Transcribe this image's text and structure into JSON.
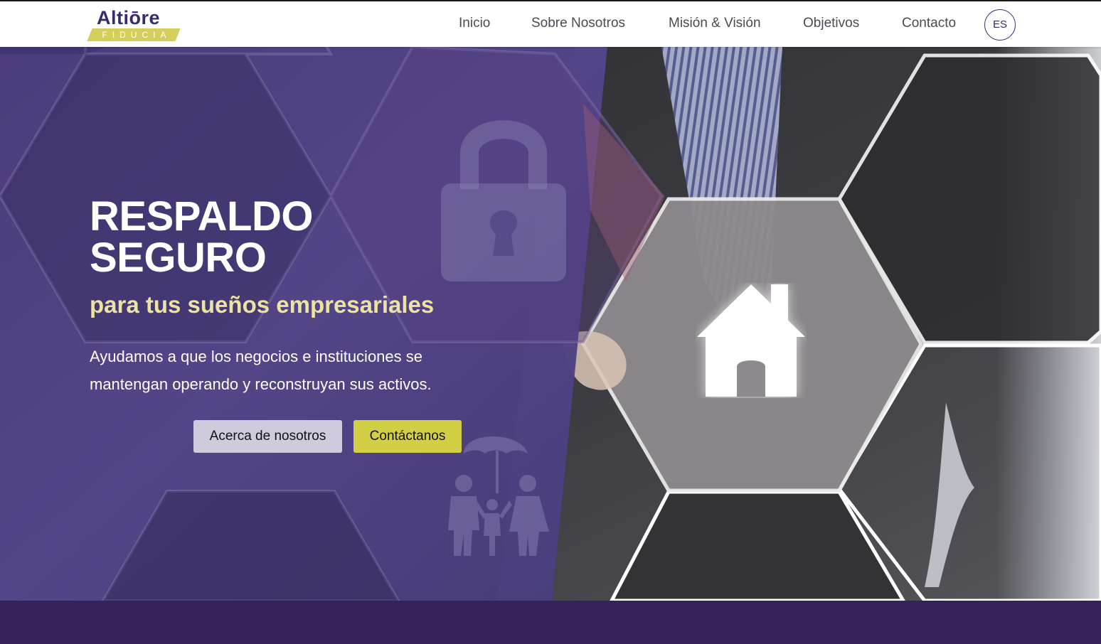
{
  "brand": {
    "name": "Altiōre",
    "tagline": "FIDUCIA",
    "colors": {
      "primary": "#3a2a6e",
      "accent": "#d3cf5a",
      "footer": "#36225a"
    }
  },
  "nav": {
    "items": [
      {
        "label": "Inicio"
      },
      {
        "label": "Sobre Nosotros"
      },
      {
        "label": "Misión & Visión"
      },
      {
        "label": "Objetivos"
      },
      {
        "label": "Contacto"
      }
    ],
    "language": "ES"
  },
  "hero": {
    "title_line1": "RESPALDO",
    "title_line2": "SEGURO",
    "subtitle": "para tus sueños empresariales",
    "description_line1": "Ayudamos a que los negocios e instituciones se",
    "description_line2": "mantengan operando y reconstruyan sus activos.",
    "button_about": "Acerca de nosotros",
    "button_contact": "Contáctanos",
    "icons": [
      "lock-icon",
      "house-icon",
      "family-umbrella-icon"
    ]
  }
}
